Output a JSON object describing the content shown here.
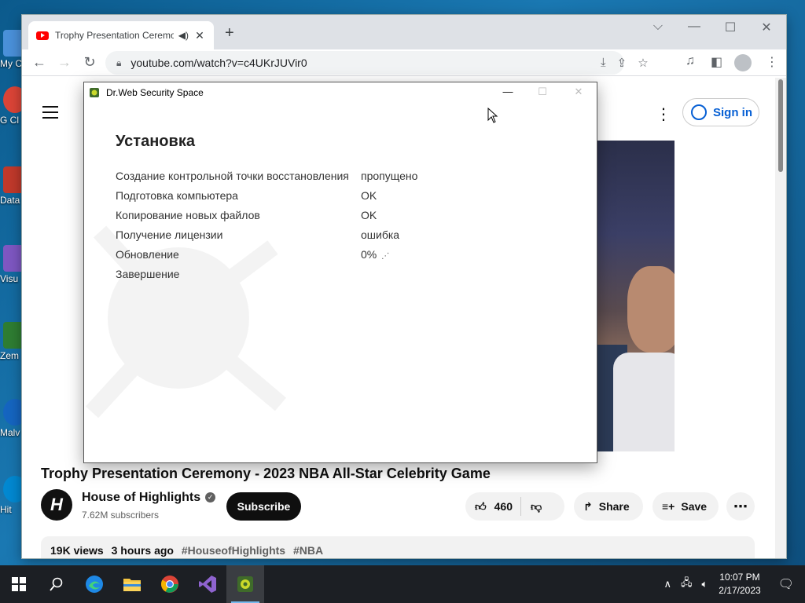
{
  "desktop": {
    "icons": [
      {
        "label": "My C",
        "color": "#4a90d9"
      },
      {
        "label": "G Cl",
        "color": "#db4437"
      },
      {
        "label": "Data",
        "color": "#c0392b"
      },
      {
        "label": "Visu",
        "color": "#7e57c2"
      },
      {
        "label": "Zem",
        "color": "#2e7d32"
      },
      {
        "label": "Malv",
        "color": "#1565c0"
      },
      {
        "label": "Hit",
        "color": "#0288d1"
      }
    ]
  },
  "browser": {
    "tab_title": "Trophy Presentation Ceremony - 2023 NBA All-Star Celebrity Game",
    "url": "youtube.com/watch?v=c4UKrJUVir0",
    "window_controls": {
      "chevron": "⌵",
      "minimize": "—",
      "maximize": "☐",
      "close": "✕"
    }
  },
  "youtube": {
    "signin_label": "Sign in",
    "video_title": "Trophy Presentation Ceremony - 2023 NBA All-Star Celebrity Game",
    "channel_name": "House of Highlights",
    "channel_initial": "H",
    "subscribers": "7.62M subscribers",
    "subscribe_label": "Subscribe",
    "likes": "460",
    "share_label": "Share",
    "save_label": "Save",
    "views": "19K views",
    "time_ago": "3 hours ago",
    "tags": [
      "#HouseofHighlights",
      "#NBA"
    ]
  },
  "drweb": {
    "title": "Dr.Web Security Space",
    "heading": "Установка",
    "steps": [
      {
        "label": "Создание контрольной точки восстановления",
        "status": "пропущено"
      },
      {
        "label": "Подготовка компьютера",
        "status": "OK"
      },
      {
        "label": "Копирование новых файлов",
        "status": "OK"
      },
      {
        "label": "Получение лицензии",
        "status": "ошибка"
      },
      {
        "label": "Обновление",
        "status": "0%"
      },
      {
        "label": "Завершение",
        "status": ""
      }
    ]
  },
  "taskbar": {
    "time": "10:07 PM",
    "date": "2/17/2023"
  }
}
